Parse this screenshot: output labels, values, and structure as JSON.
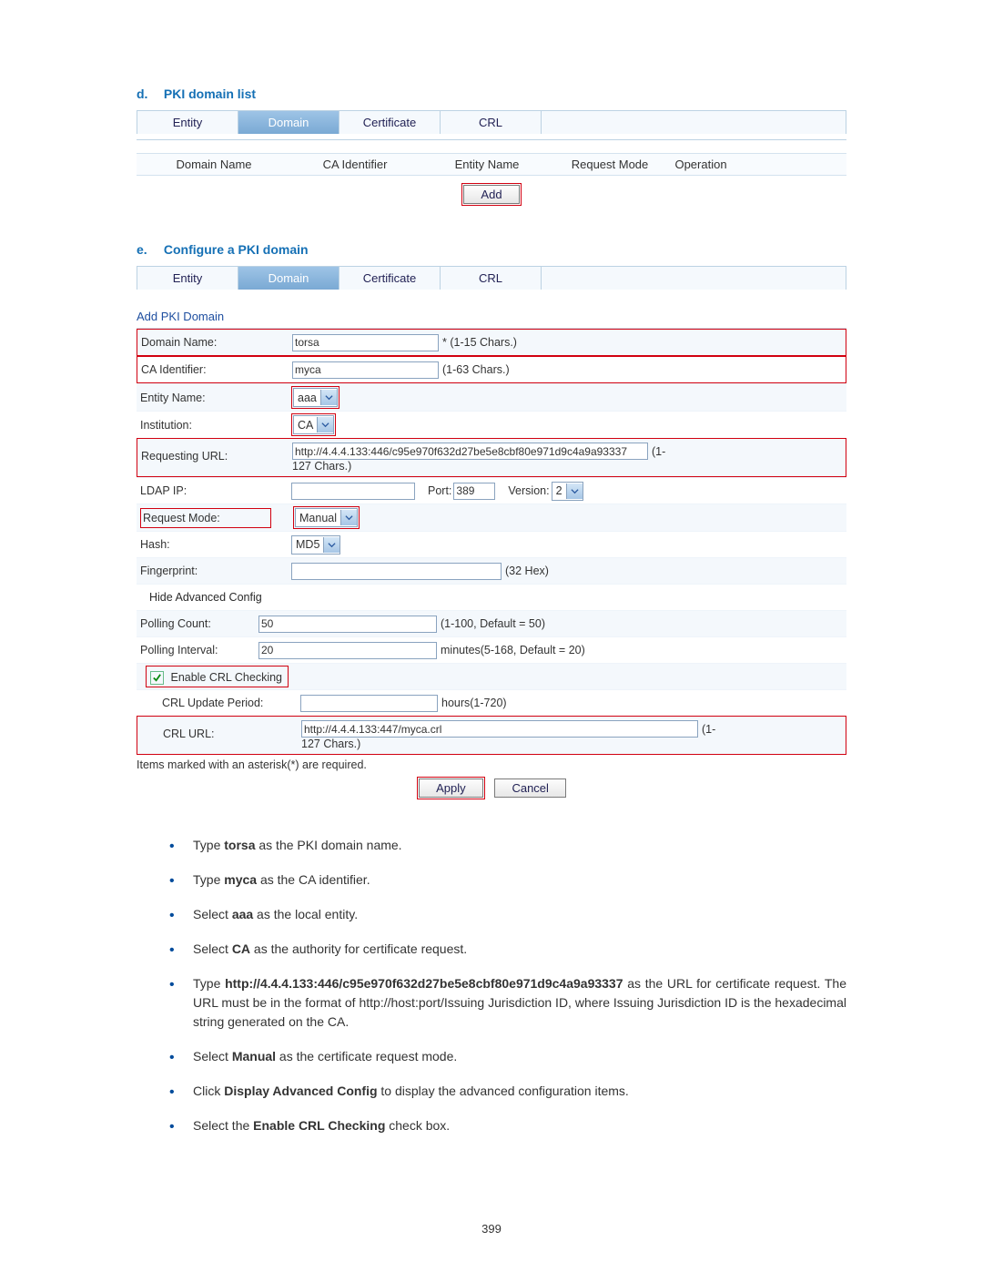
{
  "sections": {
    "d": {
      "letter": "d.",
      "title": "PKI domain list"
    },
    "e": {
      "letter": "e.",
      "title": "Configure a PKI domain"
    }
  },
  "tabs": [
    "Entity",
    "Domain",
    "Certificate",
    "CRL"
  ],
  "list_columns": [
    "Domain Name",
    "CA Identifier",
    "Entity Name",
    "Request Mode",
    "Operation"
  ],
  "add_btn": "Add",
  "form_title": "Add PKI Domain",
  "form": {
    "domain_name": {
      "label": "Domain Name:",
      "value": "torsa",
      "hint": "* (1-15 Chars.)"
    },
    "ca_id": {
      "label": "CA Identifier:",
      "value": "myca",
      "hint": "(1-63 Chars.)"
    },
    "entity": {
      "label": "Entity Name:",
      "value": "aaa"
    },
    "institution": {
      "label": "Institution:",
      "value": "CA"
    },
    "req_url": {
      "label": "Requesting URL:",
      "value": "http://4.4.4.133:446/c95e970f632d27be5e8cbf80e971d9c4a9a93337",
      "hint_prefix": "(1-",
      "hint_suffix": "127 Chars.)"
    },
    "ldap_ip": {
      "label": "LDAP IP:",
      "port_label": "Port:",
      "port_value": "389",
      "version_label": "Version:",
      "version_value": "2"
    },
    "req_mode": {
      "label": "Request Mode:",
      "value": "Manual"
    },
    "hash": {
      "label": "Hash:",
      "value": "MD5"
    },
    "fingerprint": {
      "label": "Fingerprint:",
      "hint": "(32 Hex)"
    },
    "adv_toggle": "Hide Advanced Config",
    "poll_count": {
      "label": "Polling Count:",
      "value": "50",
      "hint": "(1-100, Default = 50)"
    },
    "poll_int": {
      "label": "Polling Interval:",
      "value": "20",
      "hint": "minutes(5-168, Default = 20)"
    },
    "enable_crl": "Enable CRL Checking",
    "crl_upd": {
      "label": "CRL Update Period:",
      "hint": "hours(1-720)"
    },
    "crl_url": {
      "label": "CRL URL:",
      "value": "http://4.4.4.133:447/myca.crl",
      "hint_prefix": "(1-",
      "hint_suffix": "127 Chars.)"
    }
  },
  "required_note": "Items marked with an asterisk(*) are required.",
  "apply_btn": "Apply",
  "cancel_btn": "Cancel",
  "bullets": [
    {
      "pre": "Type ",
      "b": "torsa",
      "post": " as the PKI domain name."
    },
    {
      "pre": "Type ",
      "b": "myca",
      "post": " as the CA identifier."
    },
    {
      "pre": "Select ",
      "b": "aaa",
      "post": " as the local entity."
    },
    {
      "pre": "Select ",
      "b": "CA",
      "post": " as the authority for certificate request."
    },
    {
      "pre": "Type ",
      "b": "http://4.4.4.133:446/c95e970f632d27be5e8cbf80e971d9c4a9a93337",
      "post": " as the URL for certificate request. The URL must be in the format of http://host:port/Issuing Jurisdiction ID, where Issuing Jurisdiction ID is the hexadecimal string generated on the CA."
    },
    {
      "pre": "Select ",
      "b": "Manual",
      "post": " as the certificate request mode."
    },
    {
      "pre": "Click ",
      "b": "Display Advanced Config",
      "post": " to display the advanced configuration items."
    },
    {
      "pre": "Select the ",
      "b": "Enable CRL Checking",
      "post": " check box."
    }
  ],
  "page_number": "399"
}
